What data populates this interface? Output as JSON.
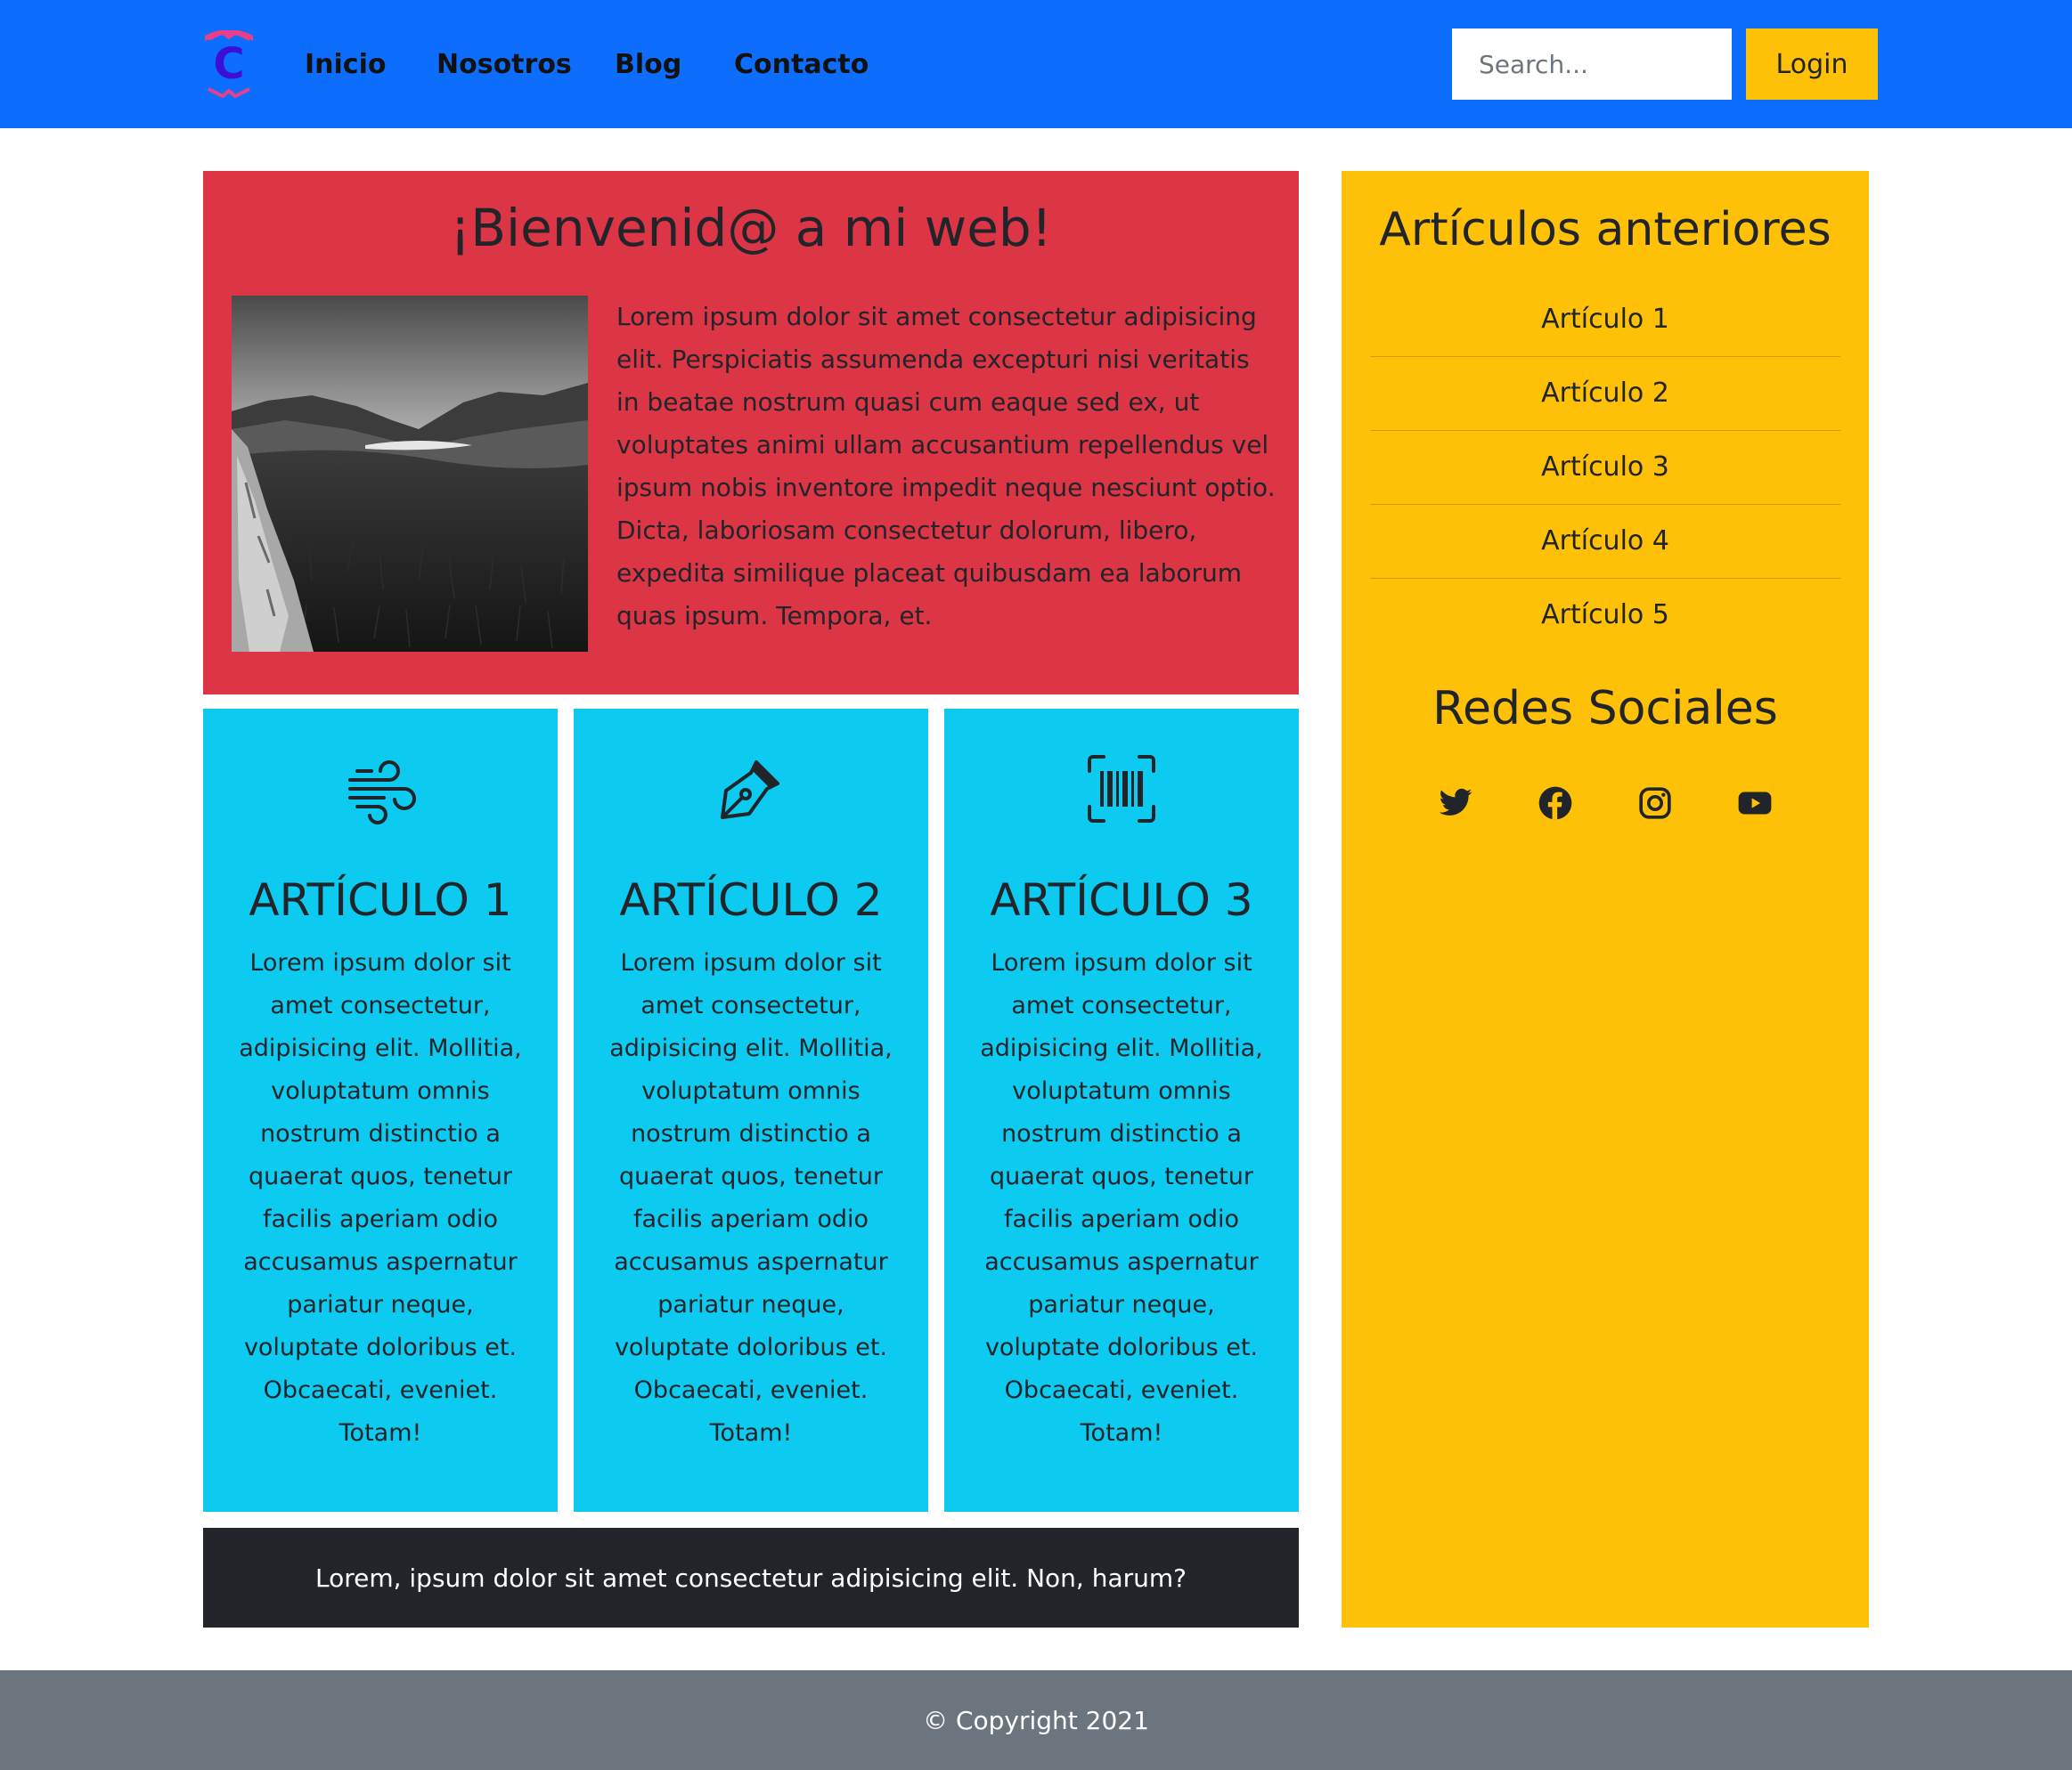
{
  "navbar": {
    "brand_letter": "C",
    "links": [
      "Inicio",
      "Nosotros",
      "Blog",
      "Contacto"
    ],
    "search_placeholder": "Search...",
    "login_label": "Login",
    "colors": {
      "background": "#0d6efd",
      "login": "#ffc107"
    }
  },
  "welcome": {
    "title": "¡Bienvenid@ a mi web!",
    "text": "Lorem ipsum dolor sit amet consectetur adipisicing elit. Perspiciatis assumenda excepturi nisi veritatis in beatae nostrum quasi cum eaque sed ex, ut voluptates animi ullam accusantium repellendus vel ipsum nobis inventore impedit neque nesciunt optio. Dicta, laboriosam consectetur dolorum, libero, expedita similique placeat quibusdam ea laborum quas ipsum. Tempora, et.",
    "image": "black-and-white-landscape-photo",
    "color": "#dc3545"
  },
  "articles": [
    {
      "icon": "wind-icon",
      "title": "ARTÍCULO 1",
      "text": "Lorem ipsum dolor sit amet consectetur, adipisicing elit. Mollitia, voluptatum omnis nostrum distinctio a quaerat quos, tenetur facilis aperiam odio accusamus aspernatur pariatur neque, voluptate doloribus et. Obcaecati, eveniet. Totam!"
    },
    {
      "icon": "pen-nib-icon",
      "title": "ARTÍCULO 2",
      "text": "Lorem ipsum dolor sit amet consectetur, adipisicing elit. Mollitia, voluptatum omnis nostrum distinctio a quaerat quos, tenetur facilis aperiam odio accusamus aspernatur pariatur neque, voluptate doloribus et. Obcaecati, eveniet. Totam!"
    },
    {
      "icon": "barcode-scan-icon",
      "title": "ARTÍCULO 3",
      "text": "Lorem ipsum dolor sit amet consectetur, adipisicing elit. Mollitia, voluptatum omnis nostrum distinctio a quaerat quos, tenetur facilis aperiam odio accusamus aspernatur pariatur neque, voluptate doloribus et. Obcaecati, eveniet. Totam!"
    }
  ],
  "banner": {
    "text": "Lorem, ipsum dolor sit amet consectetur adipisicing elit. Non, harum?"
  },
  "sidebar": {
    "title": "Artículos anteriores",
    "items": [
      "Artículo 1",
      "Artículo 2",
      "Artículo 3",
      "Artículo 4",
      "Artículo 5"
    ],
    "social_title": "Redes Sociales",
    "social_icons": [
      "twitter-icon",
      "facebook-icon",
      "instagram-icon",
      "youtube-icon"
    ],
    "color": "#ffc107"
  },
  "footer": {
    "text": "© Copyright 2021"
  }
}
